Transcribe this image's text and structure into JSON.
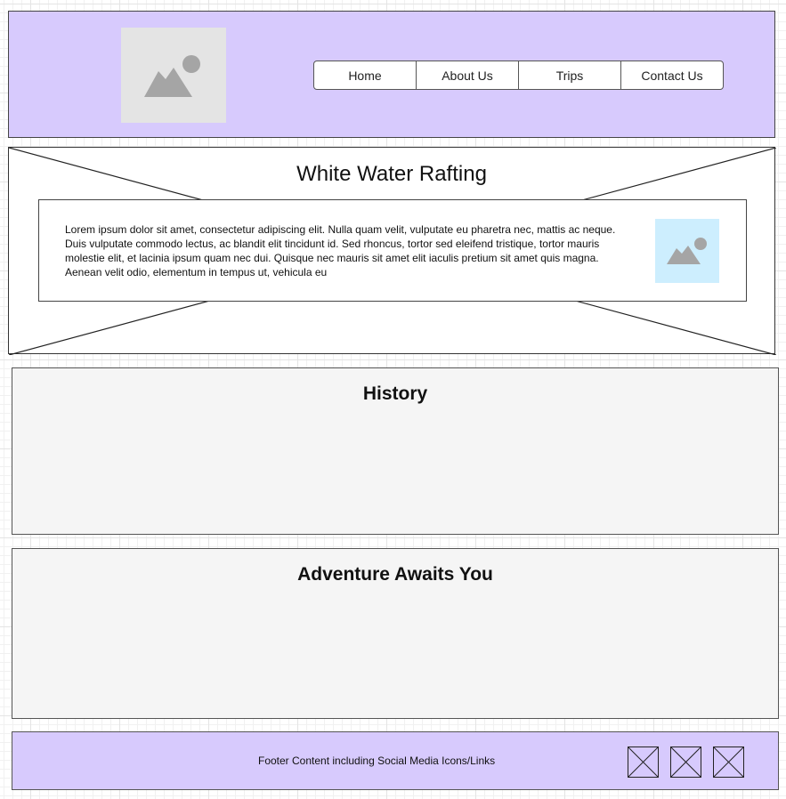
{
  "header": {
    "logo_icon": "image-placeholder-icon",
    "nav": [
      {
        "label": "Home"
      },
      {
        "label": "About Us"
      },
      {
        "label": "Trips"
      },
      {
        "label": "Contact Us"
      }
    ]
  },
  "hero": {
    "title": "White Water Rafting",
    "body": "Lorem ipsum dolor sit amet, consectetur adipiscing elit. Nulla quam velit, vulputate eu pharetra nec, mattis ac neque. Duis vulputate commodo lectus, ac blandit elit tincidunt id. Sed rhoncus, tortor sed eleifend tristique, tortor mauris molestie elit, et lacinia ipsum quam nec dui. Quisque nec mauris sit amet elit iaculis pretium sit amet quis magna. Aenean velit odio, elementum in tempus ut, vehicula eu",
    "image_icon": "image-placeholder-icon"
  },
  "history": {
    "title": "History"
  },
  "adventure": {
    "title": "Adventure Awaits You"
  },
  "footer": {
    "text": "Footer Content including Social Media Icons/Links",
    "social_icons": [
      "image-placeholder-x-icon",
      "image-placeholder-x-icon",
      "image-placeholder-x-icon"
    ]
  },
  "colors": {
    "header_bg": "#d7cafd",
    "section_bg": "#f5f5f5",
    "logo_bg": "#e4e4e4",
    "content_image_bg": "#cdeefe",
    "placeholder_glyph": "#a5a5a5"
  }
}
